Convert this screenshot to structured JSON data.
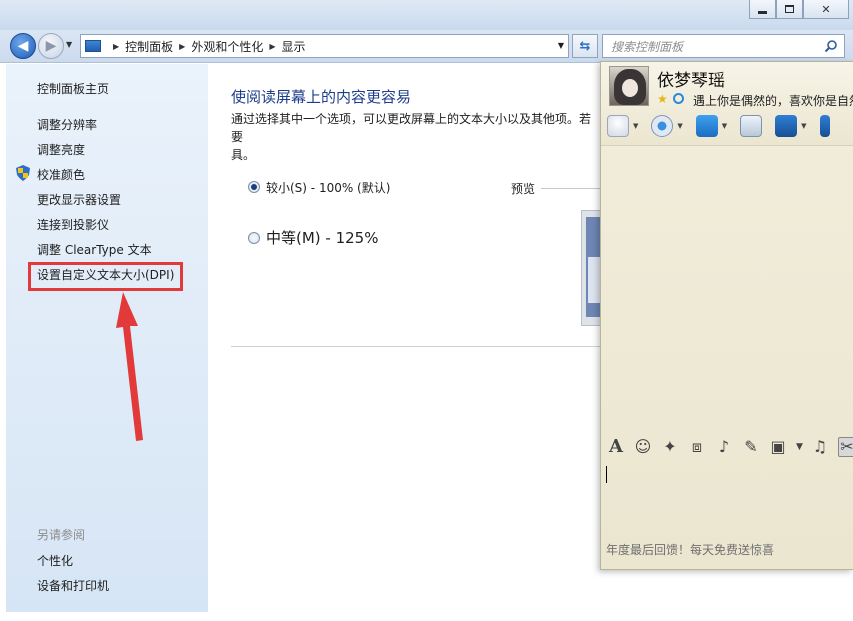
{
  "window": {
    "controls": {
      "minimize": "minimize",
      "maximize": "maximize",
      "close": "✕"
    }
  },
  "nav": {
    "breadcrumbs": [
      "控制面板",
      "外观和个性化",
      "显示"
    ],
    "search_placeholder": "搜索控制面板"
  },
  "sidebar": {
    "items": [
      {
        "label": "控制面板主页"
      },
      {
        "label": "调整分辨率"
      },
      {
        "label": "调整亮度"
      },
      {
        "label": "校准颜色"
      },
      {
        "label": "更改显示器设置"
      },
      {
        "label": "连接到投影仪"
      },
      {
        "label": "调整 ClearType 文本"
      },
      {
        "label": "设置自定义文本大小(DPI)"
      }
    ],
    "see_also": {
      "label": "另请参阅",
      "items": [
        {
          "label": "个性化"
        },
        {
          "label": "设备和打印机"
        }
      ]
    }
  },
  "main": {
    "title": "使阅读屏幕上的内容更容易",
    "description": "通过选择其中一个选项，可以更改屏幕上的文本大小以及其他项。若要",
    "description_cont": "具。",
    "options": [
      {
        "label": "较小(S) - 100% (默认)",
        "selected": true
      },
      {
        "label": "中等(M) - 125%",
        "selected": false
      }
    ],
    "preview_label": "预览"
  },
  "qq": {
    "contact_name": "依梦琴瑶",
    "status_text": "遇上你是偶然的，喜欢你是自然",
    "ad_text": "年度最后回馈！每天免费送惊喜",
    "toolbar_icons": [
      "mic-icon",
      "camera-icon",
      "folder-transfer-icon",
      "message-icon",
      "remote-desktop-icon",
      "screen-icon"
    ],
    "input_tools": [
      "font-icon",
      "emoji-icon",
      "magic-icon",
      "shake-icon",
      "voice-icon",
      "edit-icon",
      "image-icon",
      "music-icon",
      "scissors-icon"
    ]
  },
  "colors": {
    "accent": "#1e3e8c",
    "highlight_box": "#e23a3a",
    "sidebar_bg": "#dfeaf7",
    "qq_bg": "#efebd8"
  }
}
